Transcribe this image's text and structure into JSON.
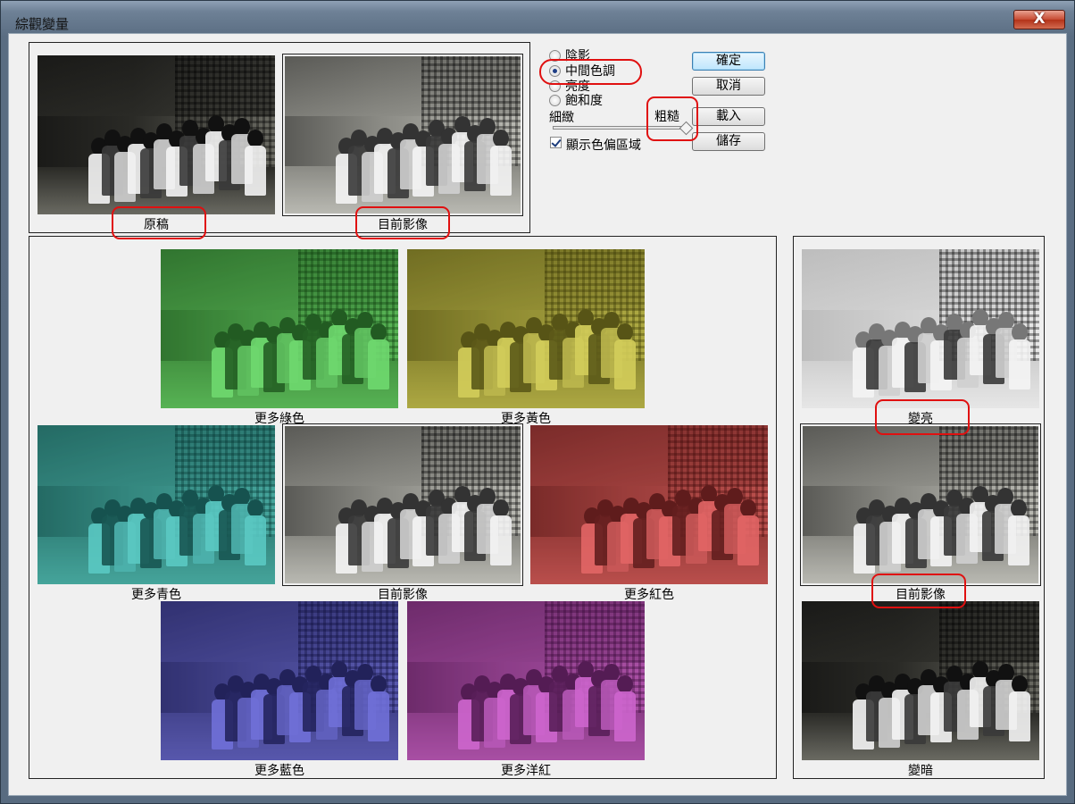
{
  "window": {
    "title": "綜觀變量",
    "close_label": "X"
  },
  "options": {
    "radios": [
      {
        "label": "陰影",
        "checked": false
      },
      {
        "label": "中間色調",
        "checked": true
      },
      {
        "label": "亮度",
        "checked": false
      },
      {
        "label": "飽和度",
        "checked": false
      }
    ],
    "slider": {
      "fine_label": "細緻",
      "coarse_label": "粗糙",
      "value_fraction": 1.0
    },
    "show_clipping": {
      "label": "顯示色偏區域",
      "checked": true
    }
  },
  "buttons": {
    "ok": "確定",
    "cancel": "取消",
    "load": "載入",
    "save": "儲存"
  },
  "thumbnails": {
    "original": "原稿",
    "current": "目前影像",
    "more_green": "更多綠色",
    "more_yellow": "更多黃色",
    "more_cyan": "更多青色",
    "center_current": "目前影像",
    "more_red": "更多紅色",
    "more_blue": "更多藍色",
    "more_magenta": "更多洋紅",
    "lighter": "變亮",
    "brightness_current": "目前影像",
    "darker": "變暗"
  },
  "tints": {
    "original": "#000000",
    "current": "#808080",
    "more_green": "#2fd22f",
    "more_yellow": "#c8c010",
    "more_cyan": "#10b8b0",
    "center_current": "#808080",
    "more_red": "#e02020",
    "more_blue": "#3030d0",
    "more_magenta": "#c020c0",
    "lighter": "#d8d8d8",
    "brightness_current": "#a0a0a0",
    "darker": "#101010"
  },
  "annotation_color": "#e01010"
}
